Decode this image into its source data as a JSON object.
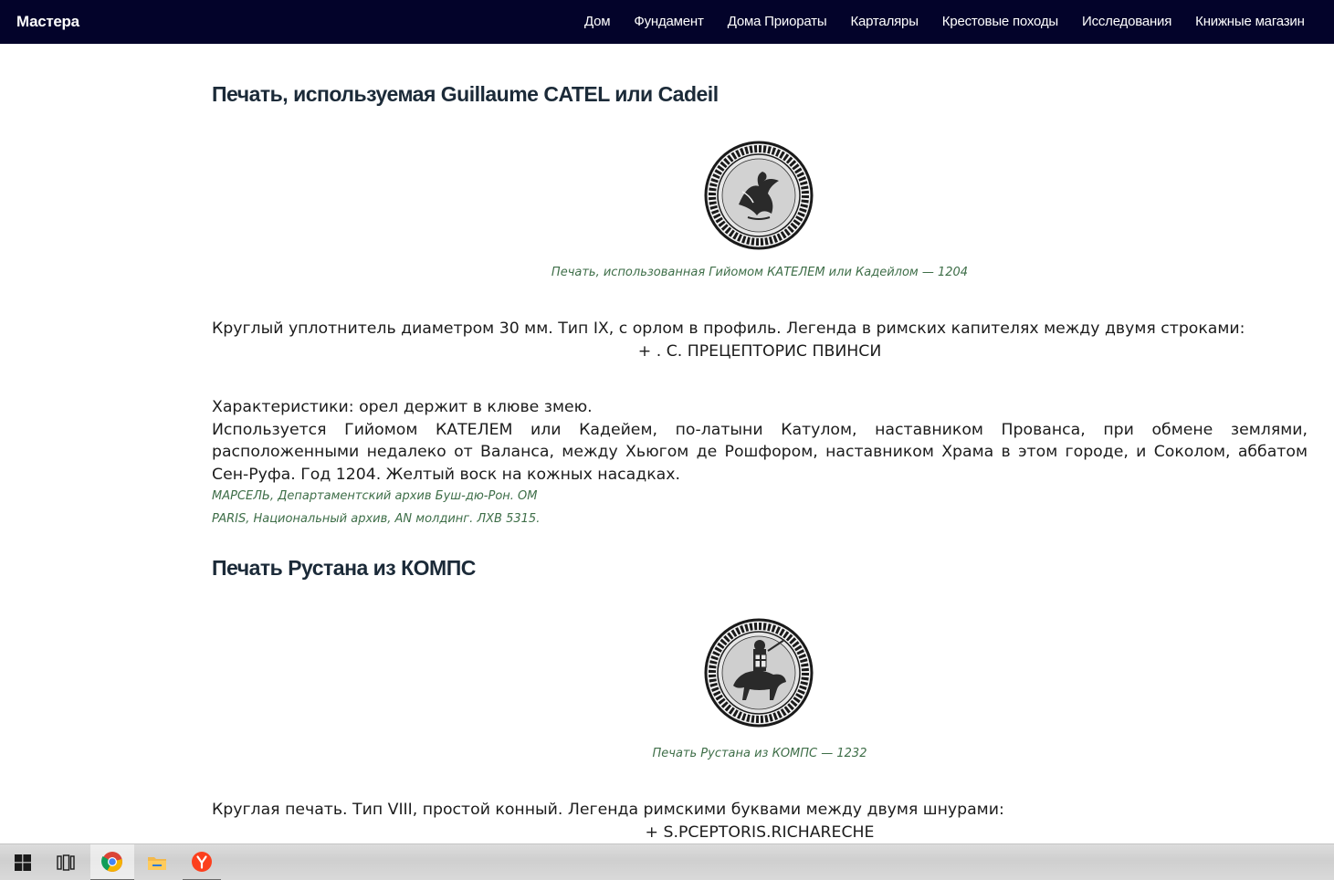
{
  "navbar": {
    "brand": "Мастера",
    "items": [
      "Дом",
      "Фундамент",
      "Дома Приораты",
      "Карталяры",
      "Крестовые походы",
      "Исследования",
      "Книжные магазин"
    ]
  },
  "section1": {
    "title": "Печать, используемая Guillaume CATEL или Cadeil",
    "caption": "Печать, использованная Гийомом КАТЕЛЕМ или Кадейлом — 1204",
    "description": "Круглый уплотнитель диаметром 30 мм. Тип IX, с орлом в профиль. Легенда в римских капителях между двумя строками:",
    "legend": "+ . С. ПРЕЦЕПТОРИС ПВИНСИ",
    "characteristics": "Характеристики: орел держит в клюве змею.",
    "usage": "Используется Гийомом КАТЕЛЕМ или Кадейем, по-латыни Катулом, наставником Прованса, при обмене землями, расположенными недалеко от Валанса, между Хьюгом де Рошфором, наставником Храма в этом городе, и Соколом, аббатом Сен-Руфа. Год 1204. Желтый воск на кожных насадках.",
    "sources": [
      "МАРСЕЛЬ, Департаментский архив Буш-дю-Рон. ОМ",
      "PARIS, Национальный архив, AN молдинг. ЛХВ 5315."
    ]
  },
  "section2": {
    "title": "Печать Рустана из КОМПС",
    "caption": "Печать Рустана из КОМПС — 1232",
    "description": "Круглая печать. Тип VIII, простой конный. Легенда римскими буквами между двумя шнурами:",
    "legend": "+ S.PCEPTORIS.RICHARECHE"
  },
  "taskbar": {
    "icons": [
      "windows-start-icon",
      "task-view-icon",
      "chrome-icon",
      "file-explorer-icon",
      "yandex-browser-icon"
    ]
  },
  "colors": {
    "navbar_bg": "#03032a",
    "caption": "#3e6e48",
    "heading": "#1b2a38"
  }
}
